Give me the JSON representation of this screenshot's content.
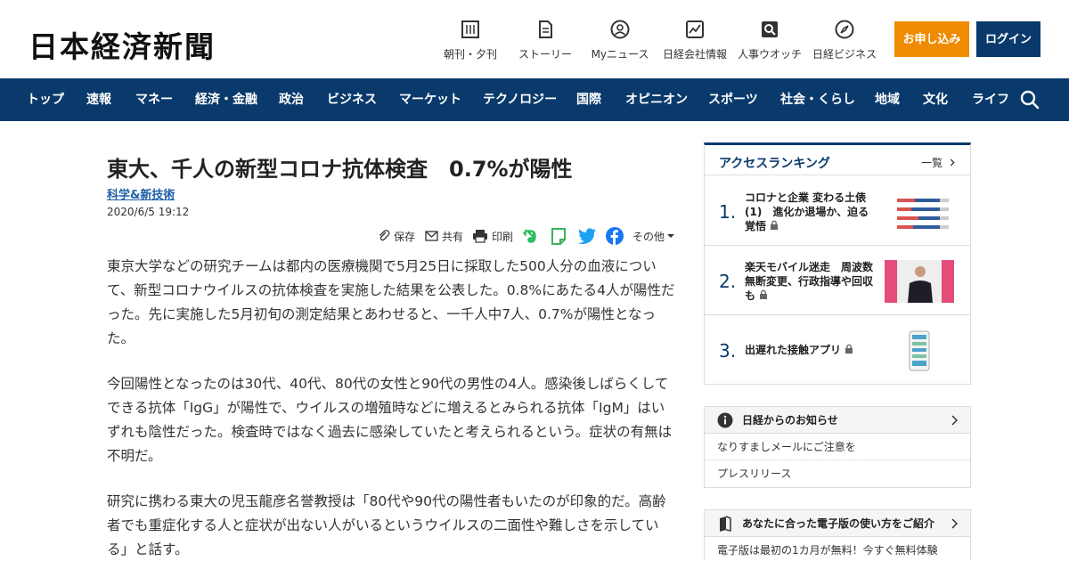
{
  "header": {
    "logo": "日本経済新聞",
    "services": [
      {
        "label": "朝刊・夕刊",
        "icon": "newspaper-icon"
      },
      {
        "label": "ストーリー",
        "icon": "document-icon"
      },
      {
        "label": "Myニュース",
        "icon": "user-icon"
      },
      {
        "label": "日経会社情報",
        "icon": "chart-icon"
      },
      {
        "label": "人事ウオッチ",
        "icon": "magnifier-icon"
      },
      {
        "label": "日経ビジネス",
        "icon": "compass-icon"
      }
    ],
    "apply_label": "お申し込み",
    "login_label": "ログイン"
  },
  "nav": {
    "items": [
      "トップ",
      "速報",
      "マネー",
      "経済・金融",
      "政治",
      "ビジネス",
      "マーケット",
      "テクノロジー",
      "国際",
      "オピニオン",
      "スポーツ",
      "社会・くらし",
      "地域",
      "文化",
      "ライフ"
    ]
  },
  "article": {
    "title": "東大、千人の新型コロナ抗体検査　0.7%が陽性",
    "category": "科学&新技術",
    "date": "2020/6/5 19:12",
    "tools": {
      "save": "保存",
      "share": "共有",
      "print": "印刷",
      "more": "その他"
    },
    "paragraphs": [
      "東京大学などの研究チームは都内の医療機関で5月25日に採取した500人分の血液について、新型コロナウイルスの抗体検査を実施した結果を公表した。0.8%にあたる4人が陽性だった。先に実施した5月初旬の測定結果とあわせると、一千人中7人、0.7%が陽性となった。",
      "今回陽性となったのは30代、40代、80代の女性と90代の男性の4人。感染後しばらくしてできる抗体「IgG」が陽性で、ウイルスの増殖時などに増えるとみられる抗体「IgM」はいずれも陰性だった。検査時ではなく過去に感染していたと考えられるという。症状の有無は不明だ。",
      "研究に携わる東大の児玉龍彦名誉教授は「80代や90代の陽性者もいたのが印象的だ。高齢者でも重症化する人と症状が出ない人がいるというウイルスの二面性や難しさを示している」と話す。"
    ]
  },
  "sidebar": {
    "ranking": {
      "title": "アクセスランキング",
      "more": "一覧",
      "items": [
        {
          "num": "1.",
          "text": "コロナと企業 変わる土俵(1)　進化か退場か、迫る覚悟"
        },
        {
          "num": "2.",
          "text": "楽天モバイル迷走　周波数無断変更、行政指導や回収も"
        },
        {
          "num": "3.",
          "text": "出遅れた接触アプリ"
        }
      ]
    },
    "notices": {
      "title": "日経からのお知らせ",
      "items": [
        "なりすましメールにご注意を",
        "プレスリリース"
      ]
    },
    "guide": {
      "title": "あなたに合った電子版の使い方をご紹介",
      "text": "電子版は最初の1カ月が無料！今すぐ無料体験"
    }
  },
  "colors": {
    "brand_navy": "#0a3a6b",
    "apply_orange": "#ef8b00",
    "category_blue": "#1f5fa8"
  }
}
